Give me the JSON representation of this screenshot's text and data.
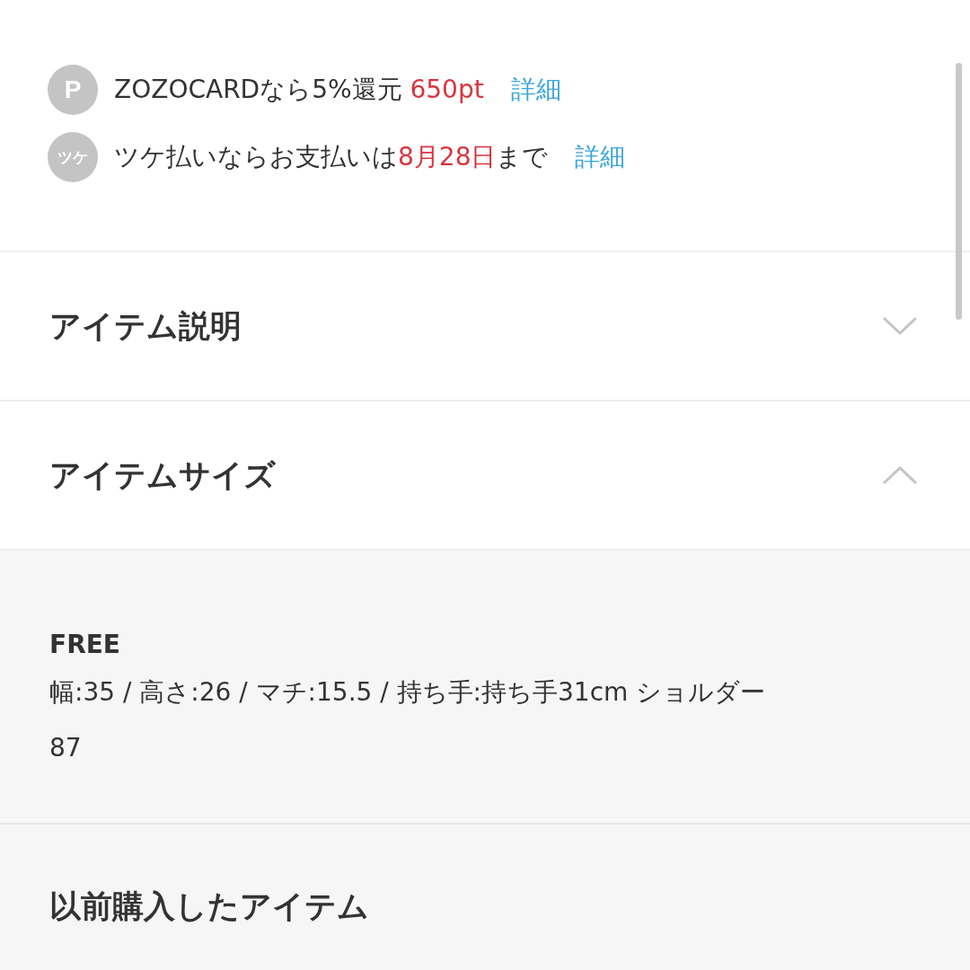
{
  "perks": [
    {
      "icon": "P",
      "parts": [
        {
          "text": "ZOZOCARDなら5%還元 ",
          "kind": "plain"
        },
        {
          "text": "650pt",
          "kind": "accent"
        }
      ],
      "link": "詳細"
    },
    {
      "icon": "ツケ",
      "parts": [
        {
          "text": "ツケ払いならお支払いは",
          "kind": "plain"
        },
        {
          "text": "8月28日",
          "kind": "accent"
        },
        {
          "text": "まで",
          "kind": "plain"
        }
      ],
      "link": "詳細"
    }
  ],
  "sections": [
    {
      "title": "アイテム説明",
      "expanded": false
    },
    {
      "title": "アイテムサイズ",
      "expanded": true,
      "sizes": [
        {
          "name": "FREE",
          "detail": "幅:35 / 高さ:26 / マチ:15.5 / 持ち手:持ち手31cm  ショルダー87"
        }
      ]
    }
  ],
  "history": {
    "title": "以前購入したアイテム"
  }
}
